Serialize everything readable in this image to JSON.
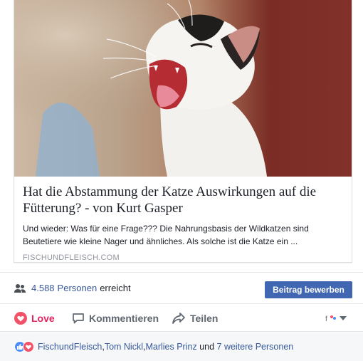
{
  "article": {
    "headline": "Hat die Abstammung der Katze Auswirkungen auf die Fütterung? - von Kurt Gasper",
    "snippet": "Und wieder: Was für eine Frage??? Die Nahrungsbasis der Wildkatzen sind Beutetiere wie kleine Nager und ähnliches. Als solche ist die Katze ein ...",
    "domain": "FISCHUNDFLEISCH.COM"
  },
  "reach": {
    "count": "4.588",
    "count_label": "Personen",
    "suffix": "erreicht",
    "boost_button": "Beitrag bewerben"
  },
  "actions": {
    "love": "Love",
    "comment": "Kommentieren",
    "share": "Teilen"
  },
  "reactions": {
    "names": [
      "FischundFleisch",
      "Tom Nickl",
      "Marlies Prinz"
    ],
    "sep1": ", ",
    "sep2": ", ",
    "connector": " und ",
    "others": "7 weitere Personen"
  },
  "colors": {
    "link": "#385898",
    "button": "#4267b2",
    "love": "#e0245e"
  },
  "icons": [
    "people-icon",
    "heart-icon",
    "comment-icon",
    "share-icon",
    "reaction-picker-icon",
    "like-reaction-icon",
    "love-reaction-icon"
  ]
}
